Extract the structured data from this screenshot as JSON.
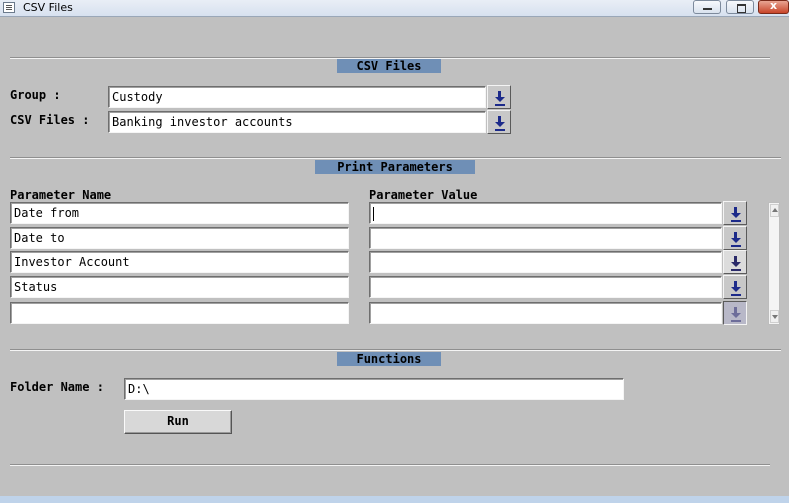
{
  "window": {
    "title": "CSV Files",
    "minimize_label": "",
    "maximize_label": "",
    "close_label": "x"
  },
  "csv_section": {
    "title": "CSV Files",
    "group_label": "Group :",
    "group_value": "Custody",
    "csv_files_label": "CSV Files :",
    "csv_files_value": "Banking investor accounts"
  },
  "print_section": {
    "title": "Print Parameters",
    "name_header": "Parameter Name",
    "value_header": "Parameter Value",
    "rows": [
      {
        "name": "Date from",
        "value": ""
      },
      {
        "name": "Date to",
        "value": ""
      },
      {
        "name": "Investor Account",
        "value": ""
      },
      {
        "name": "Status",
        "value": ""
      },
      {
        "name": "",
        "value": ""
      }
    ]
  },
  "functions_section": {
    "title": "Functions",
    "folder_label": "Folder Name :",
    "folder_value": "D:\\",
    "run_label": "Run"
  },
  "icons": {
    "dropdown": "download-arrow-icon",
    "app": "csv-app-icon"
  },
  "colors": {
    "background": "#c0c0c0",
    "section_title": "#6f8fb6",
    "dropdown_arrow": "#1c2a8a"
  }
}
